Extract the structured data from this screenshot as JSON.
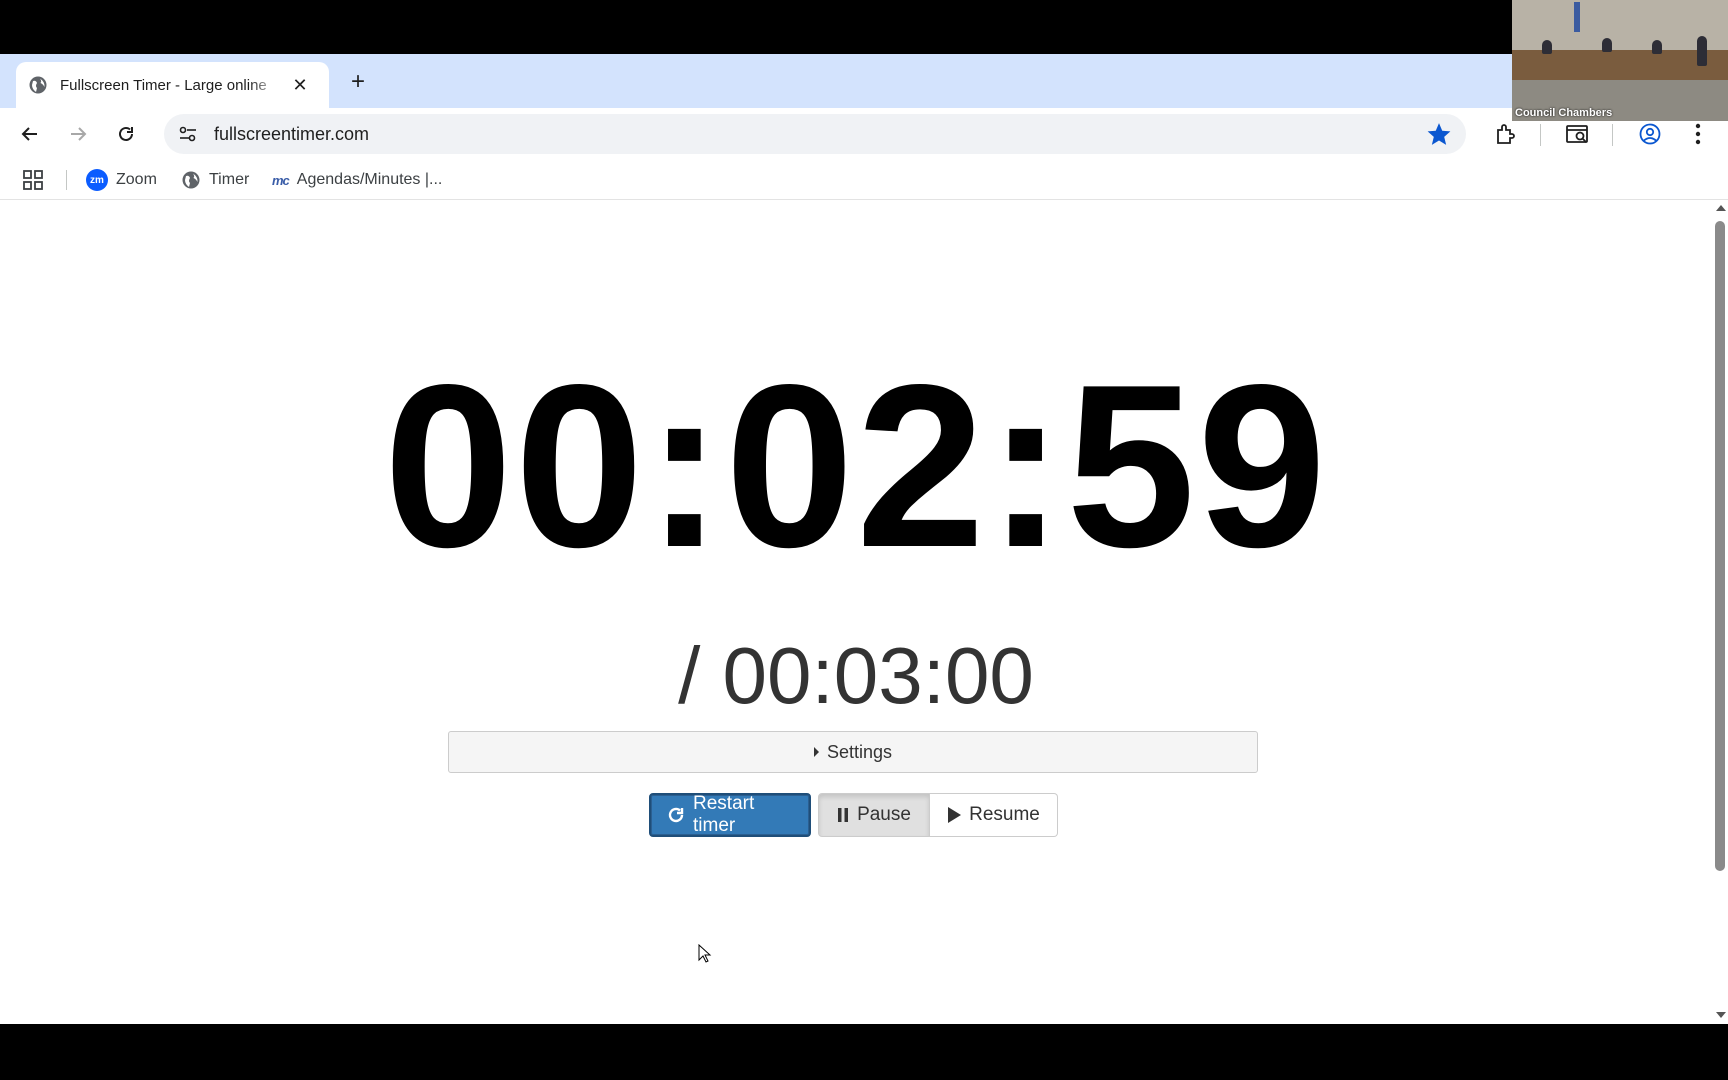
{
  "browser": {
    "tab_title": "Fullscreen Timer - Large online",
    "url": "fullscreentimer.com",
    "bookmarks": [
      {
        "label": "Zoom",
        "icon": "zoom-icon"
      },
      {
        "label": "Timer",
        "icon": "globe-icon"
      },
      {
        "label": "Agendas/Minutes |...",
        "icon": "mc-icon"
      }
    ],
    "zoom_badge": "zm",
    "mc_badge": "mc"
  },
  "timer": {
    "current": "00:02:59",
    "total": "/ 00:03:00",
    "settings_label": "Settings",
    "restart_label": "Restart timer",
    "pause_label": "Pause",
    "resume_label": "Resume"
  },
  "video": {
    "caption": "Council Chambers"
  },
  "colors": {
    "accent": "#337ab7",
    "tabstrip": "#d3e3fd",
    "star": "#0b57d0"
  }
}
